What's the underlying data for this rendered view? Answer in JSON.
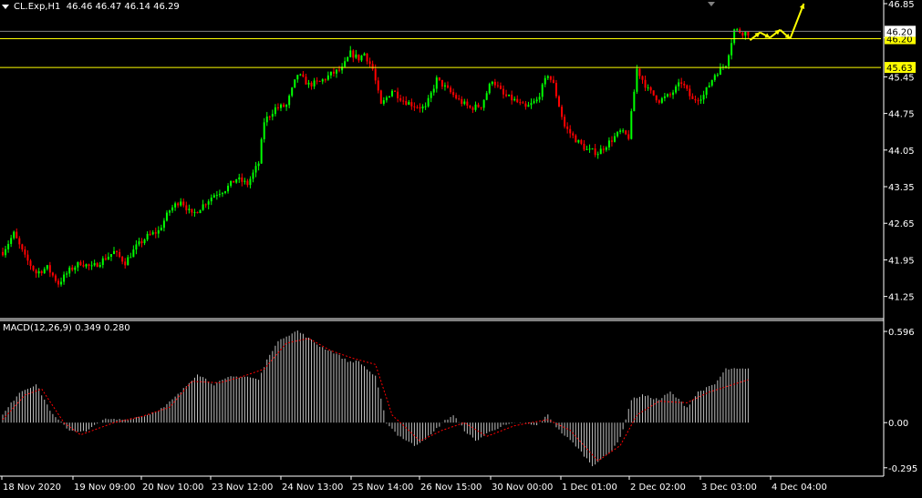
{
  "header": {
    "symbol": "CL.Exp,H1",
    "ohlc": "46.46 46.47 46.14 46.29"
  },
  "macd_header": {
    "name": "MACD(12,26,9)",
    "values": "0.349 0.280"
  },
  "colors": {
    "background": "#000000",
    "bull": "#00ff00",
    "bear": "#ff0000",
    "level_line": "#ffff00",
    "histogram": "#c0c0c0",
    "signal": "#ff0000",
    "arrow": "#ffff00",
    "axis": "#ffffff",
    "grid_line": "#808080"
  },
  "chart_data": [
    {
      "type": "candlestick",
      "title": "CL.Exp,H1",
      "ylim": [
        41.0,
        46.85
      ],
      "y_ticks": [
        "46.85",
        "46.20",
        "45.45",
        "44.75",
        "44.05",
        "43.35",
        "42.65",
        "41.95",
        "41.25"
      ],
      "x_ticks": [
        "18 Nov 2020",
        "19 Nov 09:00",
        "20 Nov 10:00",
        "23 Nov 12:00",
        "24 Nov 13:00",
        "25 Nov 14:00",
        "26 Nov 15:00",
        "30 Nov 00:00",
        "1 Dec 01:00",
        "2 Dec 02:00",
        "3 Dec 03:00",
        "4 Dec 04:00"
      ],
      "current_price_label": "46.20",
      "current_price": 46.2,
      "price_lines": [
        {
          "label": "46.20",
          "value": 46.18
        },
        {
          "label": "45.63",
          "value": 45.63
        }
      ],
      "path_key_points": [
        [
          0,
          42.1
        ],
        [
          4,
          42.45
        ],
        [
          8,
          42.0
        ],
        [
          12,
          41.7
        ],
        [
          16,
          41.8
        ],
        [
          20,
          41.5
        ],
        [
          24,
          41.75
        ],
        [
          28,
          41.9
        ],
        [
          32,
          41.8
        ],
        [
          36,
          41.95
        ],
        [
          40,
          42.1
        ],
        [
          44,
          41.9
        ],
        [
          48,
          42.2
        ],
        [
          52,
          42.4
        ],
        [
          56,
          42.5
        ],
        [
          60,
          42.9
        ],
        [
          64,
          43.1
        ],
        [
          68,
          42.8
        ],
        [
          72,
          43.0
        ],
        [
          76,
          43.2
        ],
        [
          80,
          43.3
        ],
        [
          84,
          43.5
        ],
        [
          88,
          43.4
        ],
        [
          92,
          43.8
        ],
        [
          94,
          44.6
        ],
        [
          98,
          44.85
        ],
        [
          102,
          44.9
        ],
        [
          106,
          45.5
        ],
        [
          110,
          45.3
        ],
        [
          114,
          45.35
        ],
        [
          118,
          45.5
        ],
        [
          122,
          45.6
        ],
        [
          125,
          45.9
        ],
        [
          128,
          45.8
        ],
        [
          130,
          45.9
        ],
        [
          133,
          45.6
        ],
        [
          136,
          44.9
        ],
        [
          140,
          45.2
        ],
        [
          144,
          45.0
        ],
        [
          148,
          44.9
        ],
        [
          152,
          44.85
        ],
        [
          156,
          45.4
        ],
        [
          160,
          45.2
        ],
        [
          164,
          45.0
        ],
        [
          168,
          44.85
        ],
        [
          172,
          44.9
        ],
        [
          176,
          45.4
        ],
        [
          180,
          45.1
        ],
        [
          184,
          45.0
        ],
        [
          188,
          44.85
        ],
        [
          192,
          45.0
        ],
        [
          196,
          45.5
        ],
        [
          198,
          45.3
        ],
        [
          202,
          44.5
        ],
        [
          206,
          44.25
        ],
        [
          210,
          44.05
        ],
        [
          214,
          44.0
        ],
        [
          218,
          44.2
        ],
        [
          222,
          44.4
        ],
        [
          225,
          44.3
        ],
        [
          228,
          45.6
        ],
        [
          232,
          45.2
        ],
        [
          236,
          45.0
        ],
        [
          240,
          45.1
        ],
        [
          244,
          45.35
        ],
        [
          248,
          45.0
        ],
        [
          252,
          45.1
        ],
        [
          256,
          45.5
        ],
        [
          260,
          45.7
        ],
        [
          263,
          46.35
        ],
        [
          266,
          46.3
        ],
        [
          268,
          46.29
        ]
      ],
      "projection_arrows": [
        [
          46.15,
          46.3
        ],
        [
          46.3,
          46.2
        ],
        [
          46.2,
          46.35
        ],
        [
          46.35,
          46.18
        ],
        [
          46.18,
          46.85
        ]
      ]
    },
    {
      "type": "histogram",
      "title": "MACD(12,26,9)",
      "macd_value": 0.349,
      "signal_value": 0.28,
      "ylim": [
        -0.32,
        0.62
      ],
      "y_ticks": [
        "0.596",
        "0.00",
        "-0.295"
      ],
      "path_key_points": [
        [
          0,
          0.05
        ],
        [
          6,
          0.2
        ],
        [
          12,
          0.25
        ],
        [
          18,
          0.05
        ],
        [
          24,
          -0.05
        ],
        [
          30,
          -0.06
        ],
        [
          36,
          0.02
        ],
        [
          44,
          0.02
        ],
        [
          52,
          0.05
        ],
        [
          58,
          0.1
        ],
        [
          64,
          0.2
        ],
        [
          70,
          0.32
        ],
        [
          76,
          0.25
        ],
        [
          82,
          0.3
        ],
        [
          88,
          0.3
        ],
        [
          92,
          0.28
        ],
        [
          96,
          0.45
        ],
        [
          100,
          0.55
        ],
        [
          106,
          0.6
        ],
        [
          110,
          0.55
        ],
        [
          114,
          0.5
        ],
        [
          120,
          0.45
        ],
        [
          124,
          0.4
        ],
        [
          128,
          0.4
        ],
        [
          134,
          0.3
        ],
        [
          138,
          0.0
        ],
        [
          142,
          -0.08
        ],
        [
          148,
          -0.15
        ],
        [
          154,
          -0.08
        ],
        [
          158,
          0.0
        ],
        [
          162,
          0.05
        ],
        [
          166,
          -0.05
        ],
        [
          170,
          -0.12
        ],
        [
          176,
          -0.05
        ],
        [
          180,
          -0.02
        ],
        [
          186,
          0.0
        ],
        [
          192,
          -0.02
        ],
        [
          196,
          0.05
        ],
        [
          200,
          -0.05
        ],
        [
          206,
          -0.15
        ],
        [
          212,
          -0.28
        ],
        [
          218,
          -0.2
        ],
        [
          222,
          -0.1
        ],
        [
          226,
          0.15
        ],
        [
          230,
          0.18
        ],
        [
          236,
          0.15
        ],
        [
          240,
          0.2
        ],
        [
          246,
          0.1
        ],
        [
          250,
          0.2
        ],
        [
          256,
          0.25
        ],
        [
          260,
          0.35
        ],
        [
          268,
          0.349
        ]
      ],
      "signal_key_points": [
        [
          0,
          0.02
        ],
        [
          8,
          0.18
        ],
        [
          14,
          0.22
        ],
        [
          22,
          0.0
        ],
        [
          28,
          -0.08
        ],
        [
          40,
          0.0
        ],
        [
          50,
          0.04
        ],
        [
          60,
          0.1
        ],
        [
          68,
          0.27
        ],
        [
          78,
          0.26
        ],
        [
          86,
          0.3
        ],
        [
          94,
          0.35
        ],
        [
          102,
          0.52
        ],
        [
          110,
          0.55
        ],
        [
          118,
          0.47
        ],
        [
          126,
          0.42
        ],
        [
          134,
          0.38
        ],
        [
          140,
          0.05
        ],
        [
          150,
          -0.12
        ],
        [
          158,
          -0.05
        ],
        [
          166,
          0.0
        ],
        [
          174,
          -0.09
        ],
        [
          184,
          -0.02
        ],
        [
          196,
          0.02
        ],
        [
          204,
          -0.05
        ],
        [
          214,
          -0.25
        ],
        [
          222,
          -0.15
        ],
        [
          228,
          0.05
        ],
        [
          236,
          0.14
        ],
        [
          246,
          0.13
        ],
        [
          254,
          0.2
        ],
        [
          268,
          0.28
        ]
      ]
    }
  ]
}
